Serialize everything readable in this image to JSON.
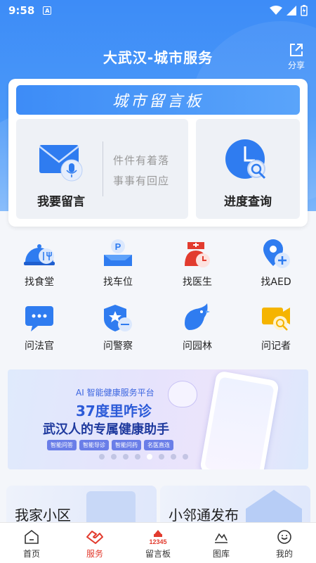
{
  "status_bar": {
    "time": "9:58",
    "sim_label": "A"
  },
  "header": {
    "title": "大武汉-城市服务",
    "share_label": "分享"
  },
  "service_card": {
    "banner_text": "城市留言板",
    "message": {
      "label": "我要留言",
      "slogan_line1": "件件有着落",
      "slogan_line2": "事事有回应"
    },
    "progress": {
      "label": "进度查询"
    }
  },
  "services": [
    {
      "label": "找食堂",
      "icon": "dining-icon"
    },
    {
      "label": "找车位",
      "icon": "parking-icon"
    },
    {
      "label": "找医生",
      "icon": "doctor-icon"
    },
    {
      "label": "找AED",
      "icon": "aed-icon"
    },
    {
      "label": "问法官",
      "icon": "judge-chat-icon"
    },
    {
      "label": "问警察",
      "icon": "police-badge-icon"
    },
    {
      "label": "问园林",
      "icon": "bird-icon"
    },
    {
      "label": "问记者",
      "icon": "camera-icon"
    }
  ],
  "promo": {
    "subtitle": "AI 智能健康服务平台",
    "headline": "37度里咋诊",
    "tagline": "武汉人的专属健康助手",
    "tags": [
      "智能问答",
      "智能导诊",
      "智能问药",
      "名医直连"
    ],
    "slide_count": 8,
    "active_slide": 4
  },
  "feature_cards": [
    {
      "label": "我家小区"
    },
    {
      "label": "小邻通发布"
    }
  ],
  "tabbar": [
    {
      "label": "首页",
      "icon": "home-icon",
      "active": false
    },
    {
      "label": "服务",
      "icon": "service-handshake-icon",
      "active": true
    },
    {
      "label": "留言板",
      "icon": "message-board-12345-icon",
      "active": false,
      "icon_text": "12345"
    },
    {
      "label": "图库",
      "icon": "gallery-icon",
      "active": false
    },
    {
      "label": "我的",
      "icon": "profile-icon",
      "active": false
    }
  ],
  "colors": {
    "primary": "#3d8cf7",
    "active_tab": "#e23b2e"
  }
}
